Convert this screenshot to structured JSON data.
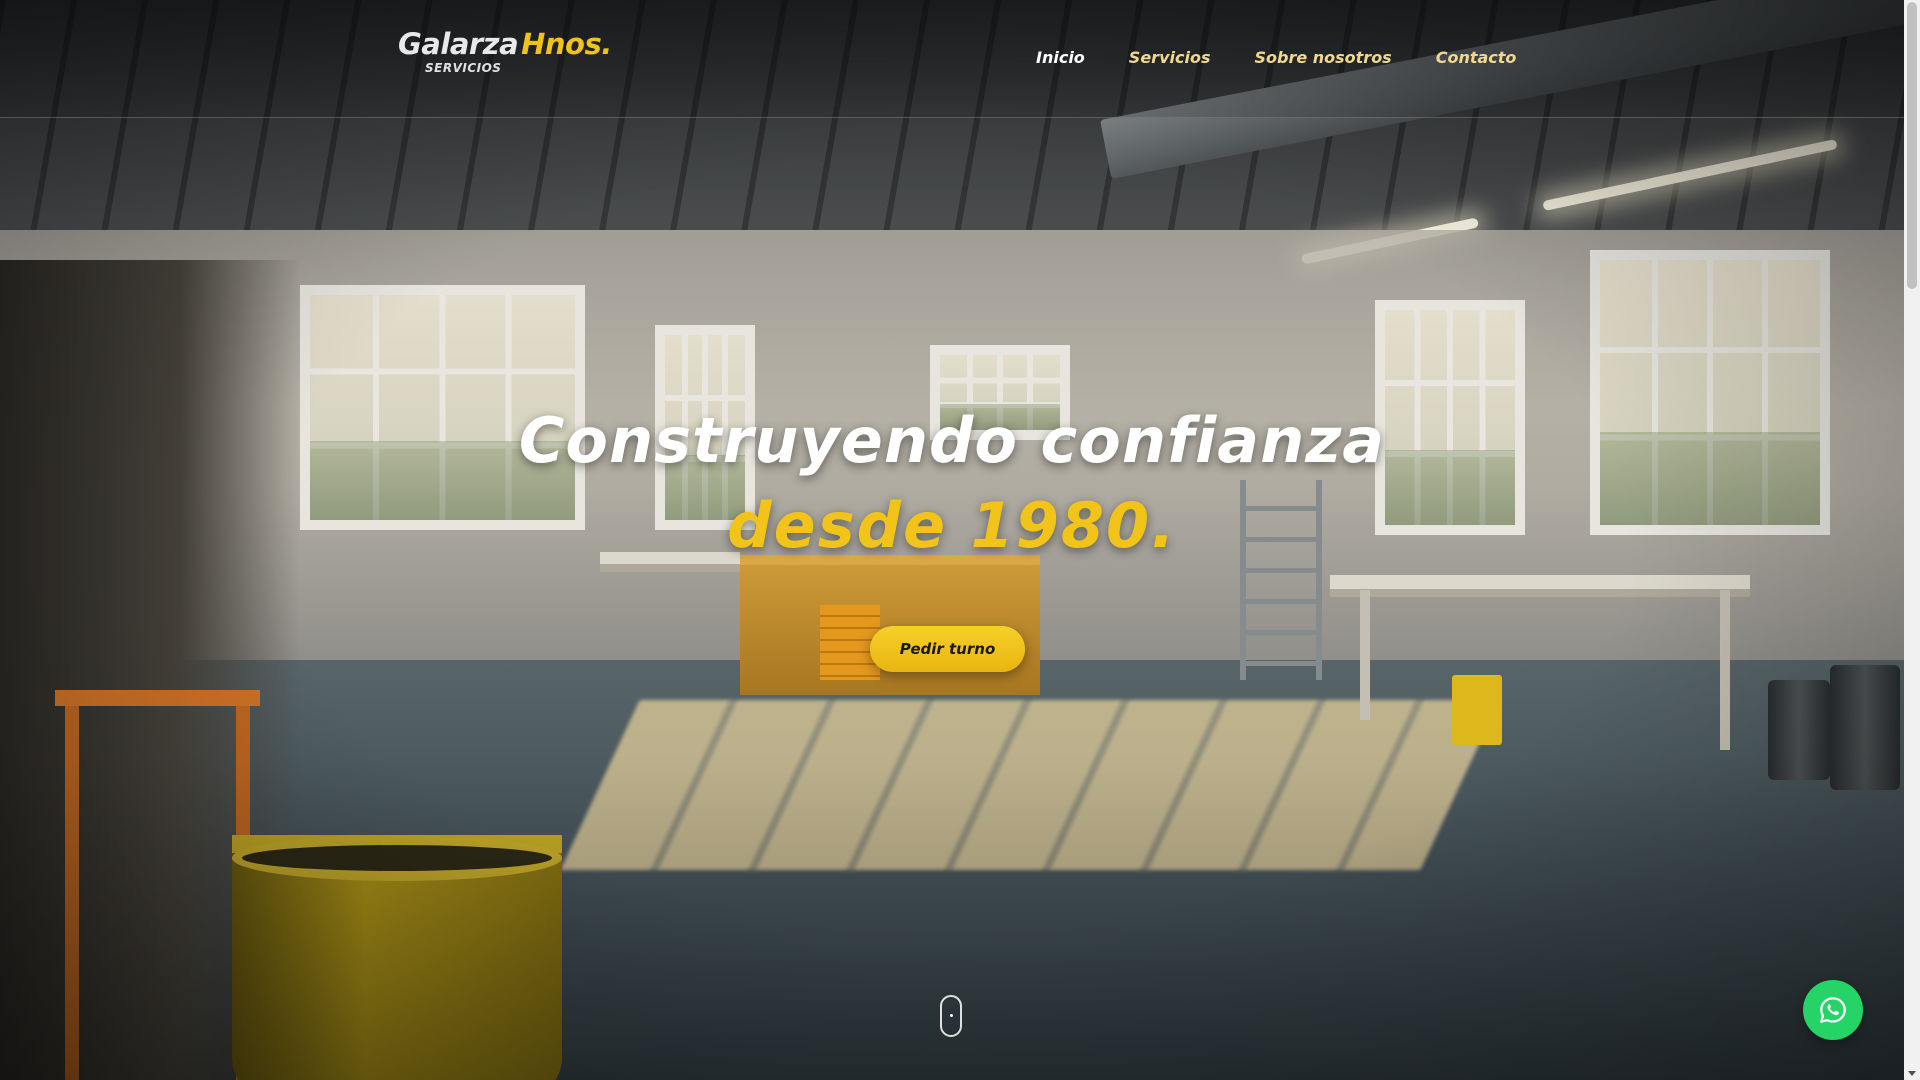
{
  "brand": {
    "name_part1": "Galarza",
    "name_part2": "Hnos.",
    "tagline": "SERVICIOS",
    "accent_color": "#f0c21a"
  },
  "nav": {
    "items": [
      {
        "label": "Inicio",
        "active": true
      },
      {
        "label": "Servicios",
        "active": false
      },
      {
        "label": "Sobre nosotros",
        "active": false
      },
      {
        "label": "Contacto",
        "active": false
      }
    ]
  },
  "hero": {
    "title_line1": "Construyendo confianza",
    "title_line2": "desde 1980.",
    "cta_label": "Pedir turno",
    "background_image": "workshop-garage-interior"
  },
  "floating": {
    "whatsapp_icon": "whatsapp-icon",
    "whatsapp_color": "#25d366",
    "scroll_icon": "mouse-scroll-icon"
  }
}
